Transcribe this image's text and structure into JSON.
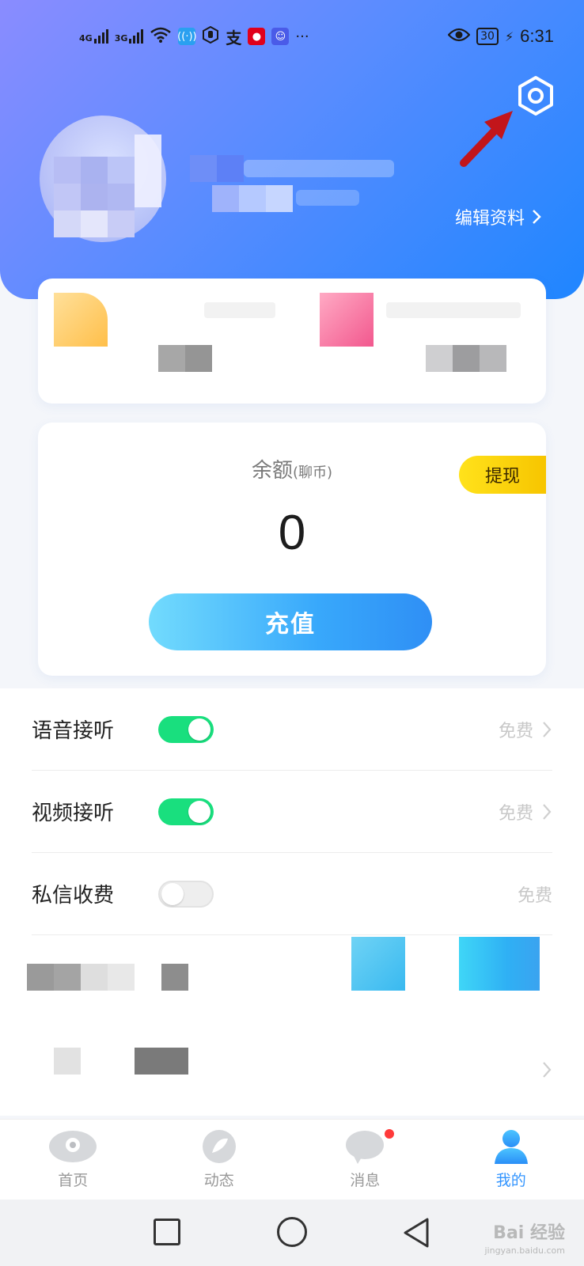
{
  "status_bar": {
    "network_1": "4G",
    "network_2": "3G",
    "app_icon_alipay": "支",
    "more": "···",
    "battery": "30",
    "time": "6:31"
  },
  "header": {
    "edit_profile_label": "编辑资料",
    "settings_icon": "gear-icon",
    "annotation_arrow": "red-arrow"
  },
  "wallet": {
    "balance_label": "余额",
    "balance_unit": "(聊币)",
    "balance_value": "0",
    "withdraw_label": "提现",
    "recharge_label": "充值"
  },
  "settings_list": [
    {
      "label": "语音接听",
      "enabled": true,
      "value": "免费",
      "has_chevron": true
    },
    {
      "label": "视频接听",
      "enabled": true,
      "value": "免费",
      "has_chevron": true
    },
    {
      "label": "私信收费",
      "enabled": false,
      "value": "免费",
      "has_chevron": false
    }
  ],
  "tabs": [
    {
      "label": "首页",
      "icon": "home-icon",
      "active": false
    },
    {
      "label": "动态",
      "icon": "feed-icon",
      "active": false
    },
    {
      "label": "消息",
      "icon": "message-icon",
      "active": false,
      "badge": true
    },
    {
      "label": "我的",
      "icon": "profile-icon",
      "active": true
    }
  ],
  "watermark": {
    "text": "Bai 经验",
    "sub": "jingyan.baidu.com"
  },
  "colors": {
    "header_start": "#8a8cff",
    "header_end": "#1f86ff",
    "toggle_on": "#19df7e",
    "accent": "#3395ff",
    "withdraw": "#f7c500"
  }
}
